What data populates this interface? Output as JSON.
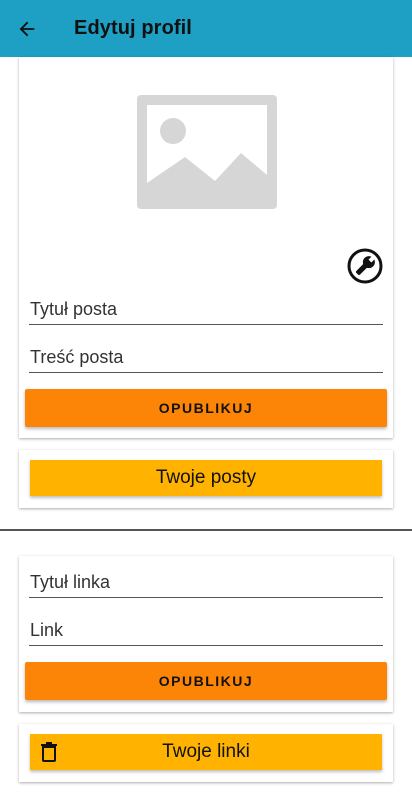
{
  "appbar": {
    "title": "Edytuj profil",
    "back_icon": "arrow-back-icon",
    "color": "#1e9fc4"
  },
  "post_form": {
    "image_icon": "image-placeholder-icon",
    "edit_icon": "wrench-icon",
    "title_placeholder": "Tytuł posta",
    "content_placeholder": "Treść posta",
    "publish_label": "OPUBLIKUJ"
  },
  "your_posts": {
    "label": "Twoje posty"
  },
  "link_form": {
    "title_placeholder": "Tytuł linka",
    "link_placeholder": "Link",
    "publish_label": "OPUBLIKUJ"
  },
  "your_links": {
    "label": "Twoje linki",
    "icon": "trash-icon"
  },
  "colors": {
    "publish": "#fc8508",
    "secondary": "#ffb300"
  }
}
